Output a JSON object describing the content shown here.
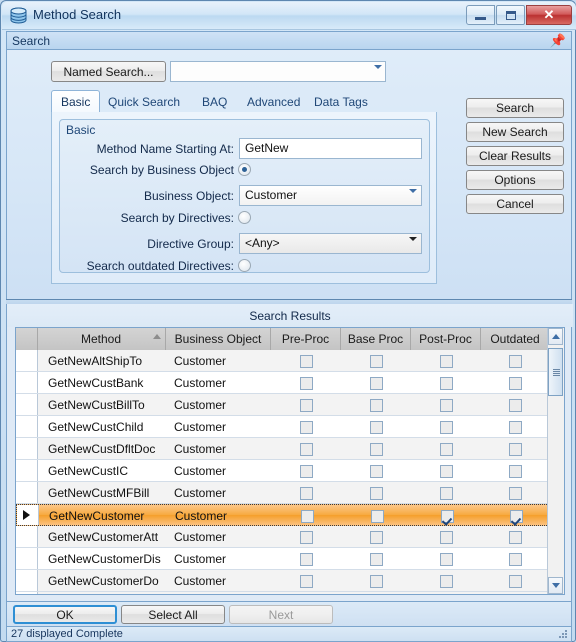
{
  "window": {
    "title": "Method Search",
    "icon": "database-icon",
    "buttons": {
      "minimize": "minimize-icon",
      "maximize": "maximize-icon",
      "close": "✕"
    }
  },
  "panel": {
    "caption": "Search",
    "pin": "pin-icon"
  },
  "search": {
    "named_search_button": "Named Search...",
    "named_search_value": "",
    "tabs": [
      {
        "label": "Basic",
        "active": true
      },
      {
        "label": "Quick Search",
        "active": false
      },
      {
        "label": "BAQ",
        "active": false
      },
      {
        "label": "Advanced",
        "active": false
      },
      {
        "label": "Data Tags",
        "active": false
      }
    ],
    "group_title": "Basic",
    "fields": {
      "method_name_label": "Method Name Starting At:",
      "method_name_value": "GetNew",
      "search_by_bo_label": "Search by Business Object",
      "search_by_bo_selected": true,
      "business_object_label": "Business Object:",
      "business_object_value": "Customer",
      "search_by_directives_label": "Search by Directives:",
      "search_by_directives_selected": false,
      "directive_group_label": "Directive Group:",
      "directive_group_value": "<Any>",
      "search_outdated_label": "Search outdated Directives:",
      "search_outdated_selected": false
    },
    "actions": [
      "Search",
      "New Search",
      "Clear Results",
      "Options",
      "Cancel"
    ]
  },
  "results": {
    "title": "Search Results",
    "columns": [
      "Method",
      "Business Object",
      "Pre-Proc",
      "Base Proc",
      "Post-Proc",
      "Outdated"
    ],
    "sorted_column": "Method",
    "rows": [
      {
        "method": "GetNewAltShipTo",
        "bo": "Customer",
        "pre": false,
        "base": false,
        "post": false,
        "outdated": false,
        "selected": false
      },
      {
        "method": "GetNewCustBank",
        "bo": "Customer",
        "pre": false,
        "base": false,
        "post": false,
        "outdated": false,
        "selected": false
      },
      {
        "method": "GetNewCustBillTo",
        "bo": "Customer",
        "pre": false,
        "base": false,
        "post": false,
        "outdated": false,
        "selected": false
      },
      {
        "method": "GetNewCustChild",
        "bo": "Customer",
        "pre": false,
        "base": false,
        "post": false,
        "outdated": false,
        "selected": false
      },
      {
        "method": "GetNewCustDfltDoc",
        "bo": "Customer",
        "pre": false,
        "base": false,
        "post": false,
        "outdated": false,
        "selected": false
      },
      {
        "method": "GetNewCustIC",
        "bo": "Customer",
        "pre": false,
        "base": false,
        "post": false,
        "outdated": false,
        "selected": false
      },
      {
        "method": "GetNewCustMFBill",
        "bo": "Customer",
        "pre": false,
        "base": false,
        "post": false,
        "outdated": false,
        "selected": false
      },
      {
        "method": "GetNewCustomer",
        "bo": "Customer",
        "pre": false,
        "base": false,
        "post": true,
        "outdated": true,
        "selected": true
      },
      {
        "method": "GetNewCustomerAtt",
        "bo": "Customer",
        "pre": false,
        "base": false,
        "post": false,
        "outdated": false,
        "selected": false
      },
      {
        "method": "GetNewCustomerDis",
        "bo": "Customer",
        "pre": false,
        "base": false,
        "post": false,
        "outdated": false,
        "selected": false
      },
      {
        "method": "GetNewCustomerDo",
        "bo": "Customer",
        "pre": false,
        "base": false,
        "post": false,
        "outdated": false,
        "selected": false
      }
    ]
  },
  "footer": {
    "ok": "OK",
    "select_all": "Select All",
    "next": "Next",
    "next_disabled": true,
    "status": "27 displayed  Complete"
  },
  "colors": {
    "accent": "#2e8fd4",
    "selection": "#f7a93f",
    "window_border": "#5e87b0",
    "close_button": "#bb3131"
  }
}
